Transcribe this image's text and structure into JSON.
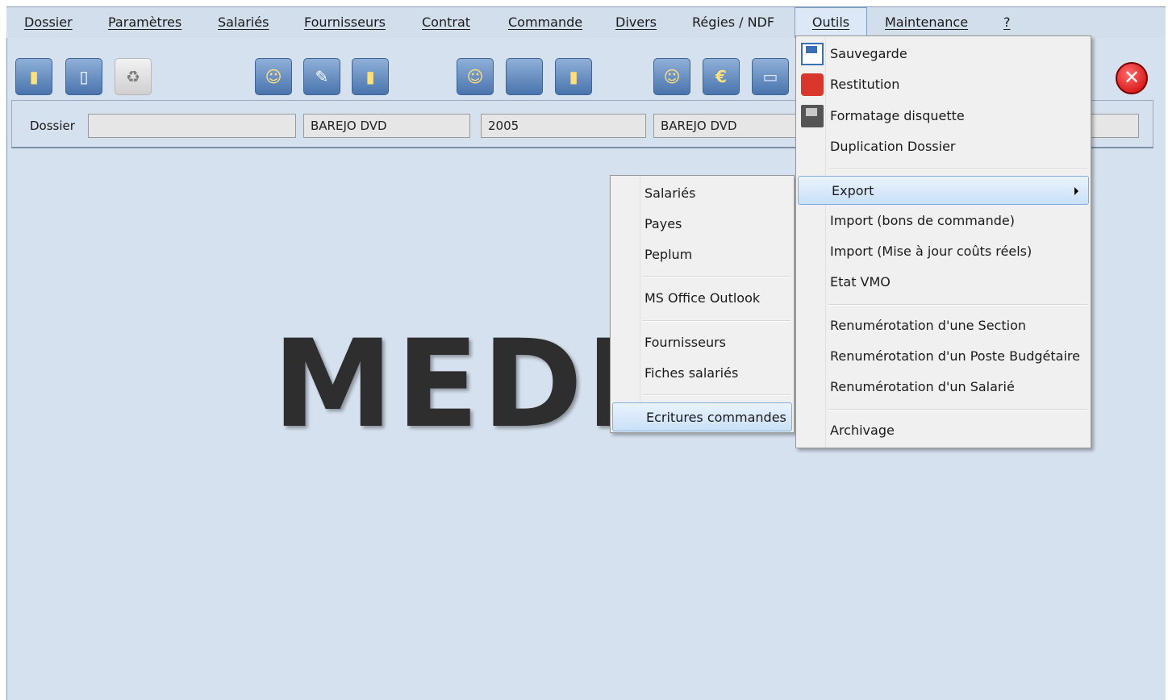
{
  "menubar": {
    "items": [
      {
        "label": "Dossier"
      },
      {
        "label": "Paramètres"
      },
      {
        "label": "Salariés"
      },
      {
        "label": "Fournisseurs"
      },
      {
        "label": "Contrat"
      },
      {
        "label": "Commande"
      },
      {
        "label": "Divers"
      },
      {
        "label": "Régies / NDF"
      },
      {
        "label": "Outils"
      },
      {
        "label": "Maintenance"
      },
      {
        "label": "?"
      }
    ],
    "active": "Outils"
  },
  "toolbar": {
    "icons": [
      "folder-icon",
      "document-icon",
      "recycle-icon",
      "person-icon",
      "edit-icon",
      "folder-open-icon",
      "person-key-icon",
      "blank-icon",
      "person-card-icon",
      "person-euro-icon",
      "euro-icon",
      "screen-icon"
    ],
    "close_icon": "close-icon"
  },
  "dossier_bar": {
    "label": "Dossier",
    "fields": [
      "",
      "BAREJO DVD",
      "2005",
      "BAREJO DVD",
      ""
    ]
  },
  "watermark": "MEDI",
  "outils_menu": {
    "items": [
      {
        "label": "Sauvegarde",
        "icon": "floppy-icon"
      },
      {
        "label": "Restitution",
        "icon": "restore-icon"
      },
      {
        "label": "Formatage disquette",
        "icon": "disk-drive-icon"
      },
      {
        "label": "Duplication Dossier"
      },
      {
        "label": "Export",
        "submenu": true,
        "highlighted": true
      },
      {
        "label": "Import (bons de commande)"
      },
      {
        "label": "Import (Mise à jour coûts réels)"
      },
      {
        "label": "Etat VMO"
      },
      {
        "label": "Renumérotation d'une Section"
      },
      {
        "label": "Renumérotation d'un Poste Budgétaire"
      },
      {
        "label": "Renumérotation d'un Salarié"
      },
      {
        "label": "Archivage"
      }
    ]
  },
  "export_submenu": {
    "items": [
      {
        "label": "Salariés"
      },
      {
        "label": "Payes"
      },
      {
        "label": "Peplum"
      },
      {
        "label": "MS Office Outlook"
      },
      {
        "label": "Fournisseurs"
      },
      {
        "label": "Fiches salariés"
      },
      {
        "label": "Ecritures commandes",
        "highlighted": true
      }
    ]
  }
}
